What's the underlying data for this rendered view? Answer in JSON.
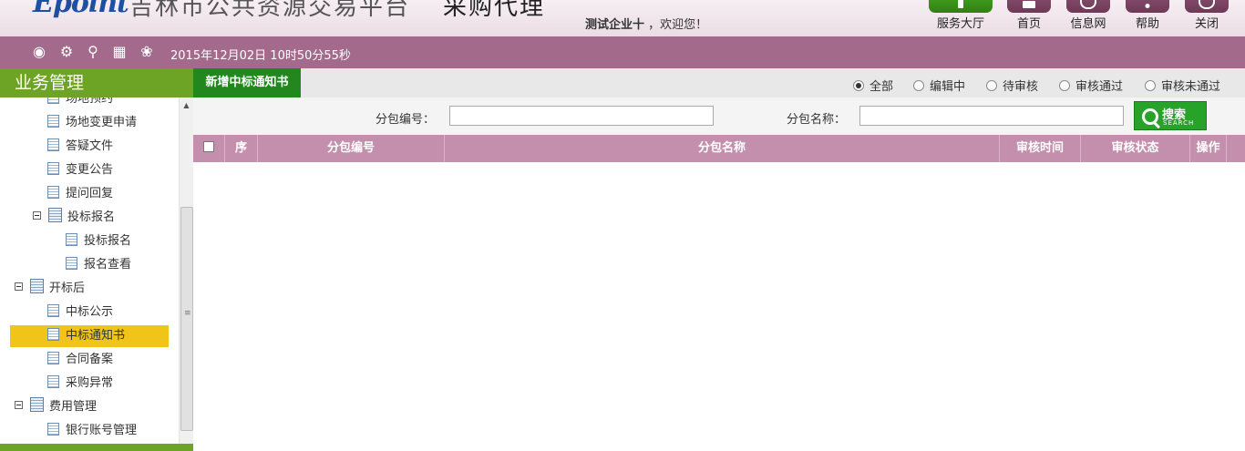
{
  "header": {
    "logo_text": "Epoint",
    "platform_title": "吉林市公共资源交易平台",
    "module_title": "采购代理",
    "welcome_user": "测试企业十",
    "welcome_suffix": "，欢迎您！",
    "tools": [
      {
        "label": "服务大厅",
        "icon": "service-hall-icon"
      },
      {
        "label": "首页",
        "icon": "home-icon"
      },
      {
        "label": "信息网",
        "icon": "globe-icon"
      },
      {
        "label": "帮助",
        "icon": "help-icon"
      },
      {
        "label": "关闭",
        "icon": "power-icon"
      }
    ]
  },
  "statusbar": {
    "icons": [
      "message-icon",
      "gear-icon",
      "key-icon",
      "gift-icon",
      "palette-icon"
    ],
    "datetime": "2015年12月02日 10时50分55秒"
  },
  "sidebar": {
    "title": "业务管理",
    "items": [
      {
        "label": "场地预约",
        "type": "leaf",
        "level": 2
      },
      {
        "label": "场地变更申请",
        "type": "leaf",
        "level": 2
      },
      {
        "label": "答疑文件",
        "type": "leaf",
        "level": 2
      },
      {
        "label": "变更公告",
        "type": "leaf",
        "level": 2
      },
      {
        "label": "提问回复",
        "type": "leaf",
        "level": 2
      },
      {
        "label": "投标报名",
        "type": "folder",
        "level": 2
      },
      {
        "label": "投标报名",
        "type": "leaf",
        "level": 3
      },
      {
        "label": "报名查看",
        "type": "leaf",
        "level": 3
      },
      {
        "label": "开标后",
        "type": "folder",
        "level": 1
      },
      {
        "label": "中标公示",
        "type": "leaf",
        "level": 2
      },
      {
        "label": "中标通知书",
        "type": "leaf",
        "level": 2,
        "selected": true
      },
      {
        "label": "合同备案",
        "type": "leaf",
        "level": 2
      },
      {
        "label": "采购异常",
        "type": "leaf",
        "level": 2
      },
      {
        "label": "费用管理",
        "type": "folder",
        "level": 1
      },
      {
        "label": "银行账号管理",
        "type": "leaf",
        "level": 2
      }
    ]
  },
  "main": {
    "new_tab_label": "新增中标通知书",
    "filters": [
      {
        "label": "全部",
        "checked": true
      },
      {
        "label": "编辑中",
        "checked": false
      },
      {
        "label": "待审核",
        "checked": false
      },
      {
        "label": "审核通过",
        "checked": false
      },
      {
        "label": "审核未通过",
        "checked": false
      }
    ],
    "search": {
      "package_no_label": "分包编号：",
      "package_no_value": "",
      "package_name_label": "分包名称：",
      "package_name_value": "",
      "button_label": "搜索",
      "button_sub": "SEARCH"
    },
    "table": {
      "columns": [
        "序",
        "分包编号",
        "分包名称",
        "审核时间",
        "审核状态",
        "操作"
      ],
      "rows": []
    }
  },
  "colors": {
    "header_bg": "#eadde4",
    "statusbar_bg": "#a36a8c",
    "sidebar_title_bg": "#6ea425",
    "selected_item_bg": "#f0c418",
    "tab_new_bg": "#22881e",
    "table_header_bg": "#c48fad",
    "search_button_bg": "#27a32a"
  }
}
